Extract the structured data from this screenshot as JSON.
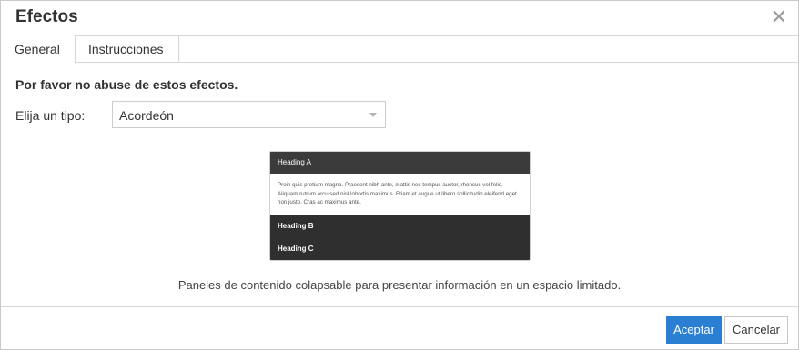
{
  "dialog": {
    "title": "Efectos",
    "close_icon": "close-icon"
  },
  "tabs": [
    {
      "label": "General",
      "active": true
    },
    {
      "label": "Instrucciones",
      "active": false
    }
  ],
  "general": {
    "warning": "Por favor no abuse de estos efectos.",
    "type_label": "Elija un tipo:",
    "type_select": {
      "value": "Acordeón"
    },
    "preview": {
      "heading_a": "Heading A",
      "body": "Proin quis pretium magna. Praesent nibh ante, mattis nec tempus auctor, rhoncus vel felis. Aliquam rutrum arcu sed nisl lobortis maximus. Etiam et augue ut libero sollicitudin eleifend eget non justo. Cras ac maximus ante.",
      "heading_b": "Heading B",
      "heading_c": "Heading C"
    },
    "description": "Paneles de contenido colapsable para presentar información en un espacio limitado."
  },
  "footer": {
    "accept_label": "Aceptar",
    "cancel_label": "Cancelar"
  },
  "colors": {
    "accent": "#2b7fd3",
    "accordion_dark": "#2f2f2f"
  }
}
